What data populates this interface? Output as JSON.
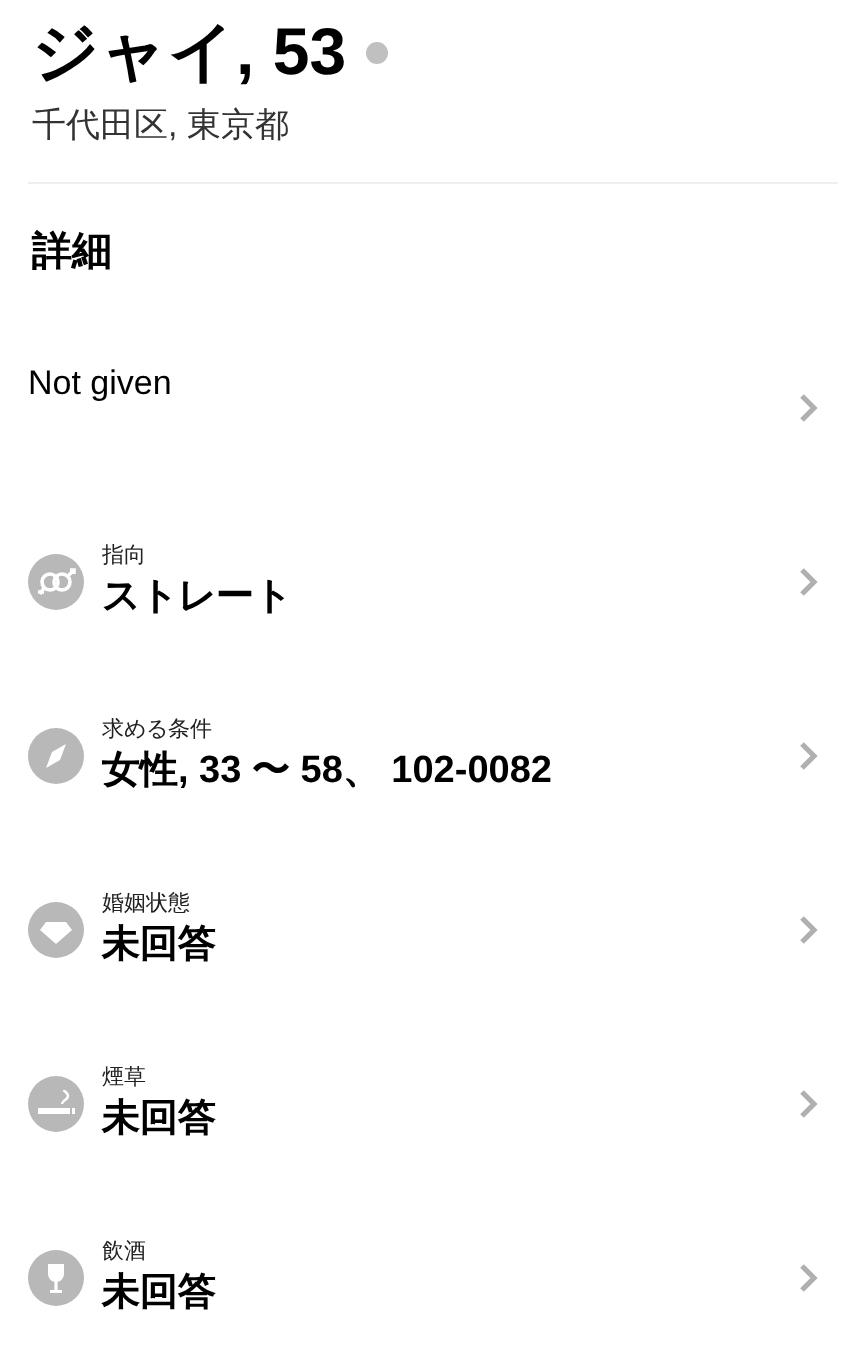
{
  "profile": {
    "name": "ジャイ, 53",
    "online": false,
    "location": "千代田区, 東京都"
  },
  "section_title": "詳細",
  "rows": [
    {
      "kind": "plain",
      "value": "Not given"
    },
    {
      "kind": "orientation",
      "label": "指向",
      "value": "ストレート"
    },
    {
      "kind": "looking_for",
      "label": "求める条件",
      "value": "女性, 33 〜 58、 102-0082"
    },
    {
      "kind": "marital",
      "label": "婚姻状態",
      "value": "未回答"
    },
    {
      "kind": "smoking",
      "label": "煙草",
      "value": "未回答"
    },
    {
      "kind": "drinking",
      "label": "飲酒",
      "value": "未回答"
    }
  ]
}
